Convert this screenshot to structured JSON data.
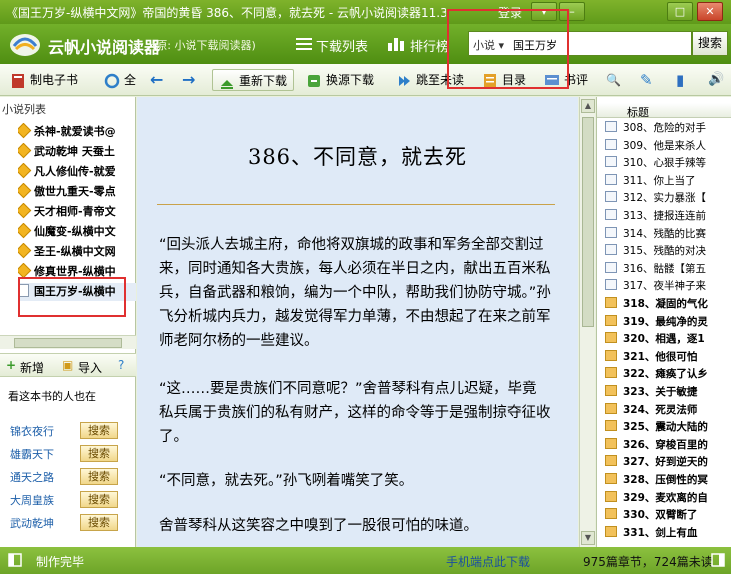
{
  "window": {
    "title": "《国王万岁-纵横中文网》帝国的黄昏 386、不同意，就去死 - 云帆小说阅读器11.3",
    "login": "登录",
    "controls": {
      "menu": "▾",
      "minimize": "–",
      "maximize": "□",
      "close": "✕"
    }
  },
  "header": {
    "app_name": "云帆小说阅读器",
    "app_subtitle": "(原: 小说下载阅读器)",
    "nav": [
      "下载列表",
      "排行榜"
    ],
    "search": {
      "category": "小说 ▾",
      "value": "国王万岁",
      "button": "搜索"
    }
  },
  "toolbar": {
    "make_ebook": "制电子书",
    "reload": "全",
    "back": "←",
    "forward": "→",
    "redownload": "重新下载",
    "switch_source": "换源下载",
    "jump_unread": "跳至未读",
    "catalog": "目录",
    "comments": "书评",
    "search_icon": "🔍",
    "edit_icon": "✎",
    "bookmark_icon": "▮",
    "sound_icon": "🔊"
  },
  "left": {
    "caption": "小说列表",
    "books": [
      "杀神-就爱读书@",
      "武动乾坤 天蚕土",
      "凡人修仙传-就爱",
      "傲世九重天-零点",
      "天才相师-青帝文",
      "仙魔变-纵横中文",
      "圣王-纵横中文网",
      "修真世界-纵横中",
      "国王万岁-纵横中"
    ],
    "actions": {
      "add": "新增",
      "import": "导入",
      "search": "?"
    },
    "also_reading_title": "看这本书的人也在",
    "also_reading": [
      "锦衣夜行",
      "雄霸天下",
      "通天之路",
      "大周皇族",
      "武动乾坤"
    ],
    "search_label": "搜索"
  },
  "reader": {
    "chapter_title": "386、不同意，就去死",
    "paragraphs": [
      "“回头派人去城主府，命他将双旗城的政事和军务全部交割过来，同时通知各大贵族，每人必须在半日之内，献出五百米私兵，自备武器和粮饷，编为一个中队，帮助我们协防守城。”孙飞分析城内兵力，越发觉得军力单薄，不由想起了在来之前军师老阿尔杨的一些建议。",
      "“这……要是贵族们不同意呢？”舍普琴科有点儿迟疑，毕竟私兵属于贵族们的私有财产，这样的命令等于是强制掠夺征收了。",
      "“不同意，就去死。”孙飞咧着嘴笑了笑。",
      "舍普琴科从这笑容之中嗅到了一股很可怕的味道。"
    ]
  },
  "chapters": {
    "header": "标题",
    "items": [
      {
        "text": "308、危险的对手",
        "read": true
      },
      {
        "text": "309、他是来杀人",
        "read": true
      },
      {
        "text": "310、心狠手辣等",
        "read": true
      },
      {
        "text": "311、你上当了",
        "read": true
      },
      {
        "text": "312、实力暴涨【",
        "read": true
      },
      {
        "text": "313、捷报连连前",
        "read": true
      },
      {
        "text": "314、残酷的比赛",
        "read": true
      },
      {
        "text": "315、残酷的对决",
        "read": true
      },
      {
        "text": "316、骷髅【第五",
        "read": true
      },
      {
        "text": "317、夜半神子来",
        "read": true
      },
      {
        "text": "318、凝固的气化",
        "read": false
      },
      {
        "text": "319、最纯净的灵",
        "read": false
      },
      {
        "text": "320、相遇，逐1",
        "read": false
      },
      {
        "text": "321、他很可怕",
        "read": false
      },
      {
        "text": "322、瘫痪了认乡",
        "read": false
      },
      {
        "text": "323、关于敏捷",
        "read": false
      },
      {
        "text": "324、死灵法师",
        "read": false
      },
      {
        "text": "325、震动大陆的",
        "read": false
      },
      {
        "text": "326、穿梭百里的",
        "read": false
      },
      {
        "text": "327、好到逆天的",
        "read": false
      },
      {
        "text": "328、压倒性的冥",
        "read": false
      },
      {
        "text": "329、麦欢离的自",
        "read": false
      },
      {
        "text": "330、双臂断了",
        "read": false
      },
      {
        "text": "331、剑上有血",
        "read": false
      }
    ]
  },
  "status": {
    "left": "制作完毕",
    "mid": "手机端点此下载",
    "right": "975篇章节，724篇未读"
  }
}
